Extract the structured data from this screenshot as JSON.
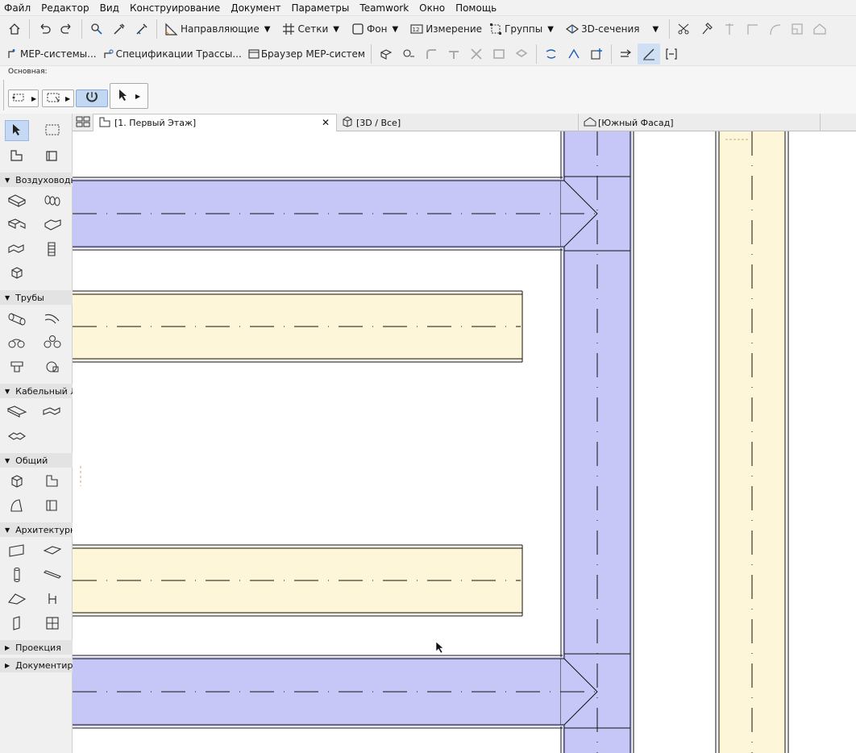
{
  "menu": {
    "items": [
      "Файл",
      "Редактор",
      "Вид",
      "Конструирование",
      "Документ",
      "Параметры",
      "Teamwork",
      "Окно",
      "Помощь"
    ]
  },
  "toolbar1": {
    "guides_label": "Направляющие",
    "grids_label": "Сетки",
    "background_label": "Фон",
    "measure_label": "Измерение",
    "groups_label": "Группы",
    "sections3d_label": "3D-сечения"
  },
  "toolbar2": {
    "mep_systems_label": "MEP-системы...",
    "route_specs_label": "Спецификации Трассы...",
    "mep_browser_label": "Браузер MEP-систем"
  },
  "infobox": {
    "title": "Основная:"
  },
  "toolbox": {
    "groups": [
      {
        "label": "Воздуховоды"
      },
      {
        "label": "Трубы"
      },
      {
        "label": "Кабельный Л"
      },
      {
        "label": "Общий"
      },
      {
        "label": "Архитектурн"
      },
      {
        "label": "Проекция"
      },
      {
        "label": "Документир"
      }
    ]
  },
  "tabs": [
    {
      "label": "[1. Первый Этаж]"
    },
    {
      "label": "[3D / Все]"
    },
    {
      "label": "[Южный Фасад]"
    }
  ],
  "colors": {
    "duct_fill": "#c7c7f7",
    "pipe_fill": "#fdf6d8",
    "outline": "#111111"
  }
}
